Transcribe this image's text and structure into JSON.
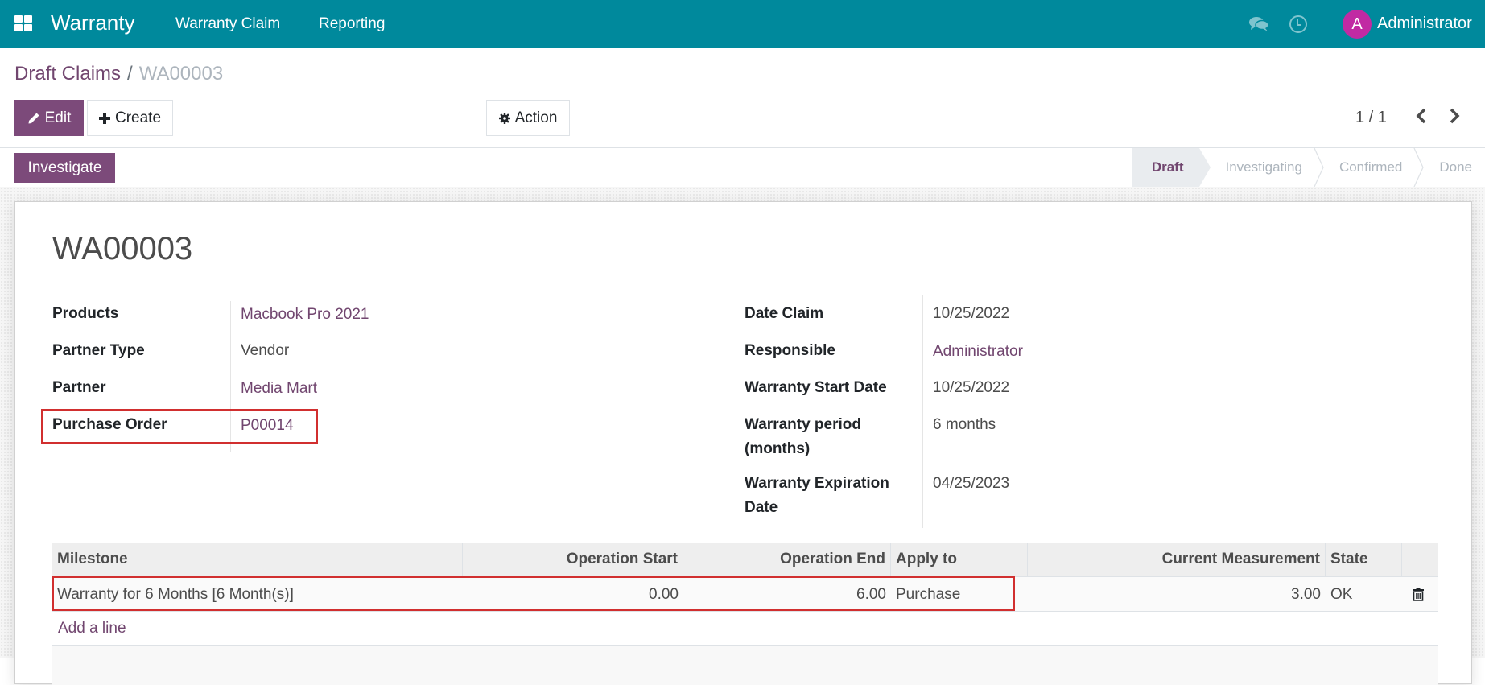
{
  "navbar": {
    "brand": "Warranty",
    "menu": [
      "Warranty Claim",
      "Reporting"
    ],
    "user": {
      "initial": "A",
      "name": "Administrator",
      "avatar_color": "#c12aa3"
    },
    "bg_color": "#00899c"
  },
  "breadcrumb": {
    "parent": "Draft Claims",
    "separator": "/",
    "current": "WA00003"
  },
  "toolbar": {
    "edit_label": "Edit",
    "create_label": "Create",
    "action_label": "Action"
  },
  "pager": {
    "value": "1 / 1",
    "prev": "‹",
    "next": "›"
  },
  "statusbar": {
    "button_label": "Investigate",
    "stages": [
      "Draft",
      "Investigating",
      "Confirmed",
      "Done"
    ],
    "active_stage": "Draft"
  },
  "record": {
    "title": "WA00003",
    "left_fields": [
      {
        "label": "Products",
        "value": "Macbook Pro 2021",
        "link": true
      },
      {
        "label": "Partner Type",
        "value": "Vendor",
        "link": false
      },
      {
        "label": "Partner",
        "value": "Media Mart",
        "link": true
      },
      {
        "label": "Purchase Order",
        "value": "P00014",
        "link": true
      }
    ],
    "right_fields": [
      {
        "label": "Date Claim",
        "value": "10/25/2022",
        "link": false
      },
      {
        "label": "Responsible",
        "value": "Administrator",
        "link": true
      },
      {
        "label": "Warranty Start Date",
        "value": "10/25/2022",
        "link": false
      },
      {
        "label_line1": "Warranty period",
        "label_line2": "(months)",
        "value": "6 months",
        "link": false
      },
      {
        "label_line1": "Warranty Expiration",
        "label_line2": "Date",
        "value": "04/25/2023",
        "link": false
      }
    ]
  },
  "milestones": {
    "columns": [
      "Milestone",
      "Operation Start",
      "Operation End",
      "Apply to",
      "Current Measurement",
      "State"
    ],
    "rows": [
      {
        "milestone": "Warranty for 6 Months [6 Month(s)]",
        "operation_start": "0.00",
        "operation_end": "6.00",
        "apply_to": "Purchase",
        "current_measurement": "3.00",
        "state": "OK"
      }
    ],
    "add_line_label": "Add a line"
  }
}
